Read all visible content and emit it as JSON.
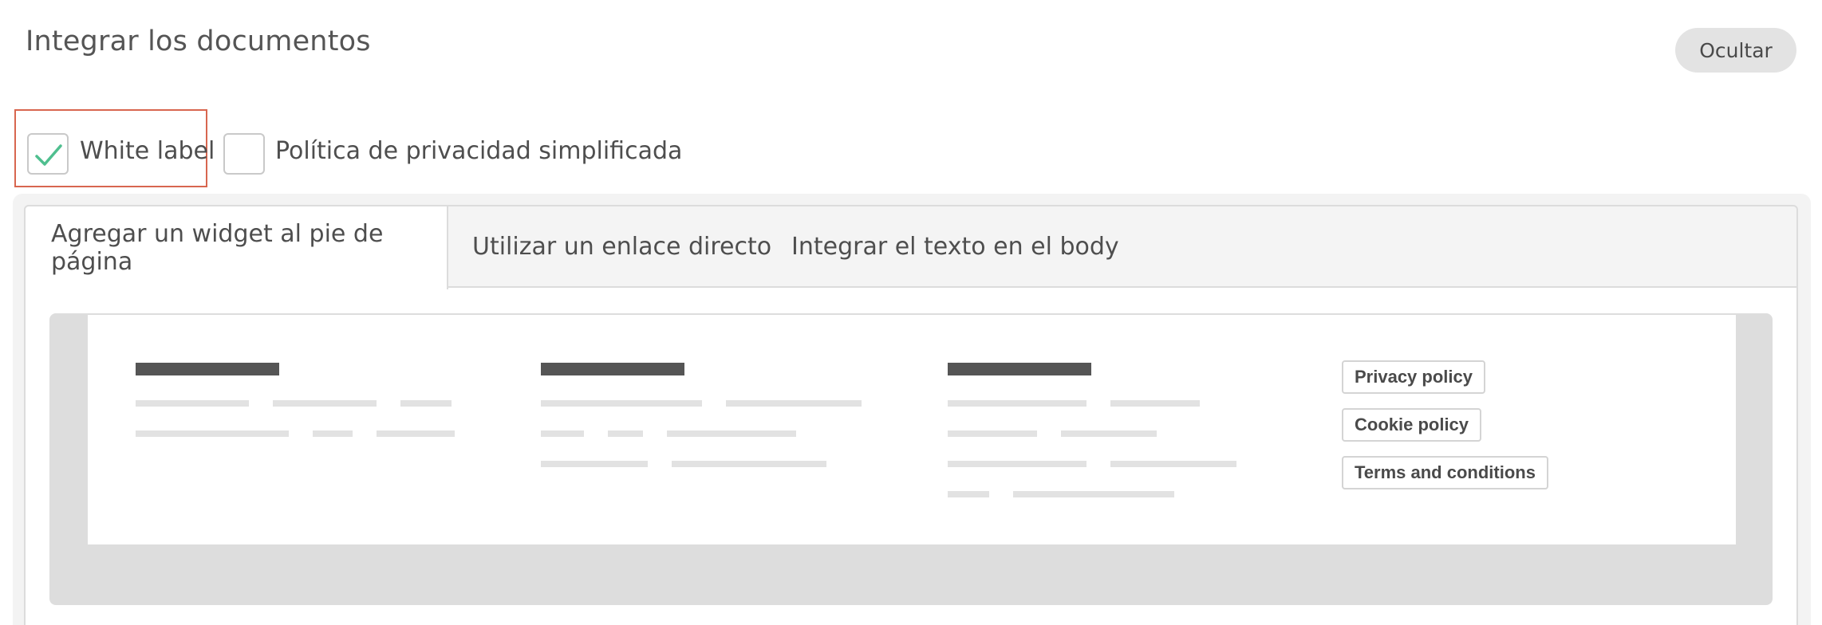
{
  "header": {
    "title": "Integrar los documentos",
    "hide_label": "Ocultar"
  },
  "options": [
    {
      "label": "White label",
      "checked": true
    },
    {
      "label": "Política de privacidad simplificada",
      "checked": false
    }
  ],
  "tabs": [
    {
      "label": "Agregar un widget al pie de página",
      "active": true
    },
    {
      "label": "Utilizar un enlace directo",
      "active": false
    },
    {
      "label": "Integrar el texto en el body",
      "active": false
    }
  ],
  "preview": {
    "links": [
      "Privacy policy",
      "Cookie policy",
      "Terms and conditions"
    ]
  },
  "colors": {
    "accent_check": "#4fbf8f",
    "highlight_border": "#d8664f"
  }
}
